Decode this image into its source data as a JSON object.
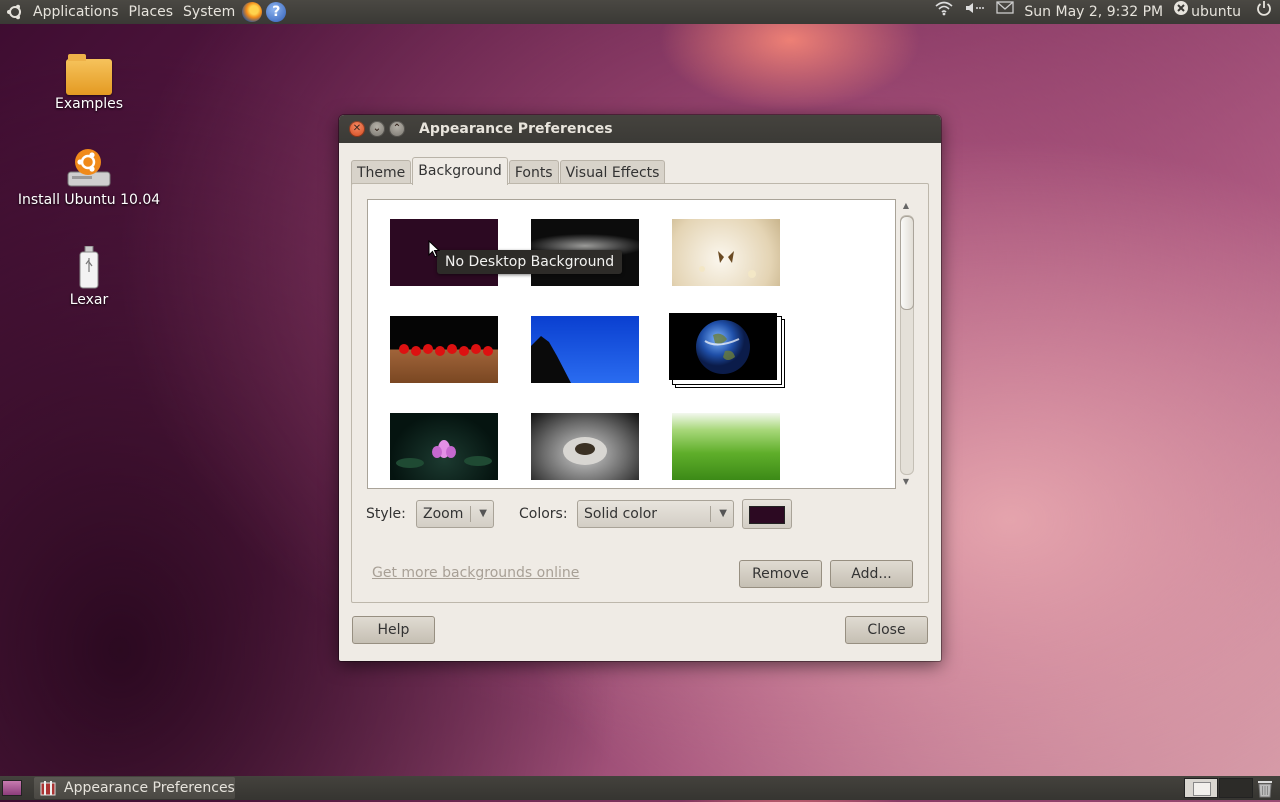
{
  "top_panel": {
    "menus": [
      "Applications",
      "Places",
      "System"
    ],
    "clock": "Sun May  2,  9:32 PM",
    "user": "ubuntu",
    "volume_icon": "volume-icon",
    "network_icon": "wifi-icon"
  },
  "desktop": {
    "icons": [
      {
        "label": "Examples"
      },
      {
        "label": "Install Ubuntu 10.04"
      },
      {
        "label": "Lexar"
      }
    ]
  },
  "dialog": {
    "title": "Appearance Preferences",
    "tabs": [
      {
        "label": "Theme",
        "active": false
      },
      {
        "label": "Background",
        "active": true
      },
      {
        "label": "Fonts",
        "active": false
      },
      {
        "label": "Visual Effects",
        "active": false
      }
    ],
    "tooltip": "No Desktop Background",
    "wallpapers": [
      {
        "name": "no-desktop-background",
        "color": "#2c0922"
      },
      {
        "name": "dark-clouds"
      },
      {
        "name": "butterfly-flowers"
      },
      {
        "name": "cherries"
      },
      {
        "name": "blue-sky-rock"
      },
      {
        "name": "earth"
      },
      {
        "name": "lotus"
      },
      {
        "name": "hands-seeds"
      },
      {
        "name": "green-grass"
      }
    ],
    "style_label": "Style:",
    "style_value": "Zoom",
    "colors_label": "Colors:",
    "colors_value": "Solid color",
    "color_swatch": "#2c0922",
    "more_link": "Get more backgrounds online",
    "remove_button": "Remove",
    "add_button": "Add...",
    "help_button": "Help",
    "close_button": "Close"
  },
  "bottom_panel": {
    "task_label": "Appearance Preferences"
  }
}
